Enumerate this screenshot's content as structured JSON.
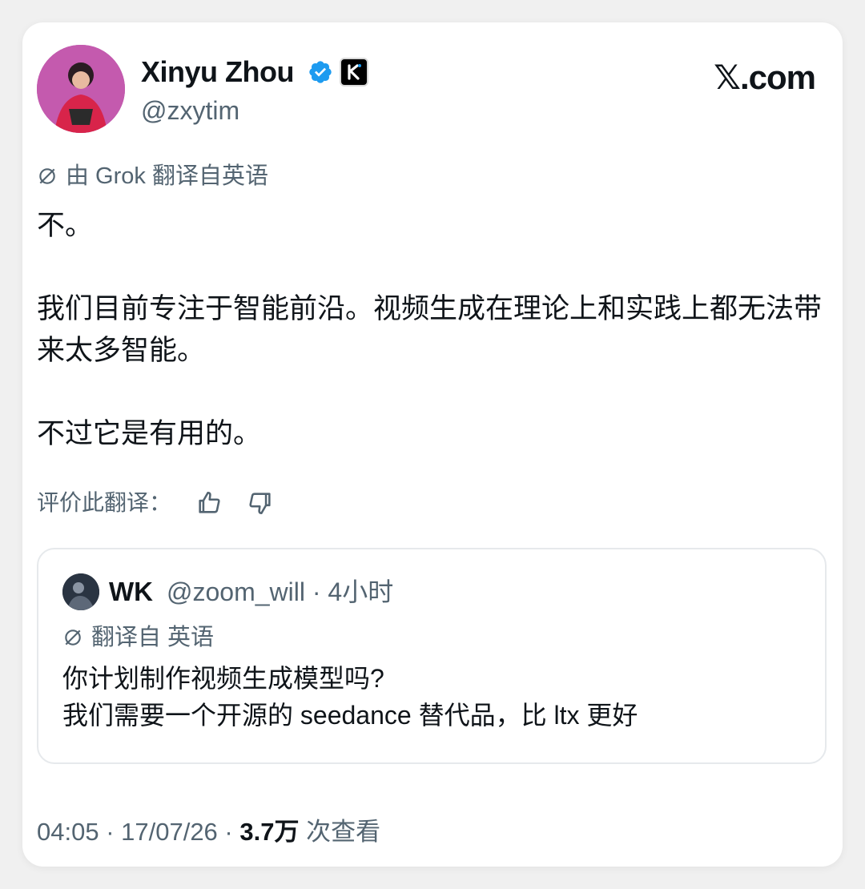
{
  "author": {
    "name": "Xinyu Zhou",
    "handle": "@zxytim"
  },
  "brand": "𝕏.com",
  "colors": {
    "verified": "#1d9bf0",
    "secondary_text": "#536471",
    "primary_text": "#0f1419"
  },
  "tweet": {
    "translation_note": "由 Grok 翻译自英语",
    "paragraphs": [
      "不。",
      "我们目前专注于智能前沿。视频生成在理论上和实践上都无法带来太多智能。",
      "不过它是有用的。"
    ],
    "rate_label": "评价此翻译："
  },
  "quoted_tweet": {
    "name": "WK",
    "meta": "@zoom_will · 4小时",
    "translation_note": "翻译自 英语",
    "lines": [
      "你计划制作视频生成模型吗?",
      "我们需要一个开源的 seedance 替代品，比 ltx 更好"
    ]
  },
  "footer": {
    "time": "04:05 · 17/07/26 · ",
    "views_count": "3.7万",
    "views_label": " 次查看"
  },
  "icons": {
    "verified": "verified-badge-icon",
    "org_badge": "kimi-k-logo-icon",
    "translate": "grok-slash-icon",
    "thumbs_up": "thumbs-up-icon",
    "thumbs_down": "thumbs-down-icon"
  }
}
